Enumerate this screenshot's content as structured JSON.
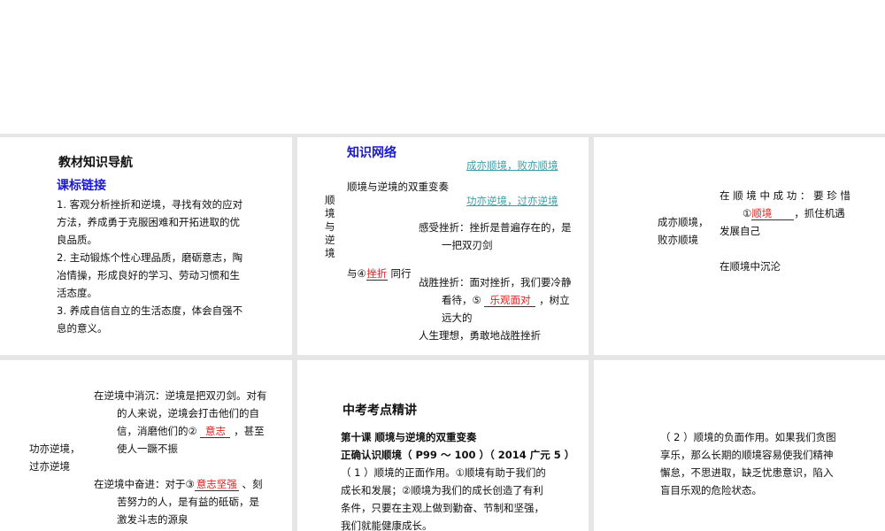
{
  "panel1": {
    "title": "教材知识导航",
    "subtitle": "课标链接",
    "lines": [
      "1. 客观分析挫折和逆境，寻找有效的应对",
      "方法，养成勇于克服困难和开拓进取的优",
      "良品质。",
      "2. 主动锻炼个性心理品质，磨砺意志，陶",
      "冶情操，形成良好的学习、劳动习惯和生",
      "活态度。",
      "3. 养成自信自立的生活态度，体会自强不",
      "息的意义。"
    ]
  },
  "panel2": {
    "title": "知识网络",
    "link1": "成亦顺境，败亦顺境",
    "link2": "功亦逆境，过亦逆境",
    "branch": "顺境与逆境的双重变奏",
    "root": "顺境与逆境",
    "with_prefix": "与④",
    "blank4": "挫折",
    "with_suffix": "同行",
    "feel1": "感受挫折：挫折是普遍存在的，是",
    "feel2": "一把双刃剑",
    "win1": "战胜挫折：面对挫折，我们要冷静",
    "win2_prefix": "看待，⑤",
    "blank5": "乐观面对",
    "win2_suffix": "，树立",
    "win3": "远大的",
    "win4": "人生理想，勇敢地战胜挫折"
  },
  "panel3": {
    "left1": "成亦顺境，",
    "left2": "败亦顺境",
    "succ1": "在 顺 境 中 成 功 ： 要 珍 惜",
    "succ2_prefix": "①",
    "blank1": "顺境",
    "succ2_suffix": "，抓住机遇",
    "succ3": "发展自己",
    "fail": "在顺境中沉沦"
  },
  "panel4": {
    "left1": "功亦逆境，",
    "left2": "过亦逆境",
    "sink1": "在逆境中消沉：逆境是把双刃剑。对有",
    "sink2": "的人来说，逆境会打击他们的自",
    "sink3_prefix": "信，消磨他们的②",
    "blank2": "意志",
    "sink3_suffix": "，甚至",
    "sink4": "使人一蹶不振",
    "rise1_prefix": "在逆境中奋进：对于③",
    "blank3": "意志坚强",
    "rise1_suffix": "、刻",
    "rise2": "苦努力的人，是有益的砥砺，是",
    "rise3": "激发斗志的源泉"
  },
  "panel5": {
    "title": "中考考点精讲",
    "lesson": "第十课 顺境与逆境的双重变奏",
    "topic": "正确认识顺境（ P99 ～ 100 ）（ 2014 广元 5 ）",
    "lines": [
      "（ 1 ）顺境的正面作用。①顺境有助于我们的",
      "成长和发展；②顺境为我们的成长创造了有利",
      "条件，只要在主观上做到勤奋、节制和坚强，",
      "我们就能健康成长。"
    ]
  },
  "panel6": {
    "lines": [
      "（ 2 ）顺境的负面作用。如果我们贪图",
      "享乐，那么长期的顺境容易使我们精神",
      "懈怠，不思进取，缺乏忧患意识，陷入",
      "盲目乐观的危险状态。"
    ]
  }
}
